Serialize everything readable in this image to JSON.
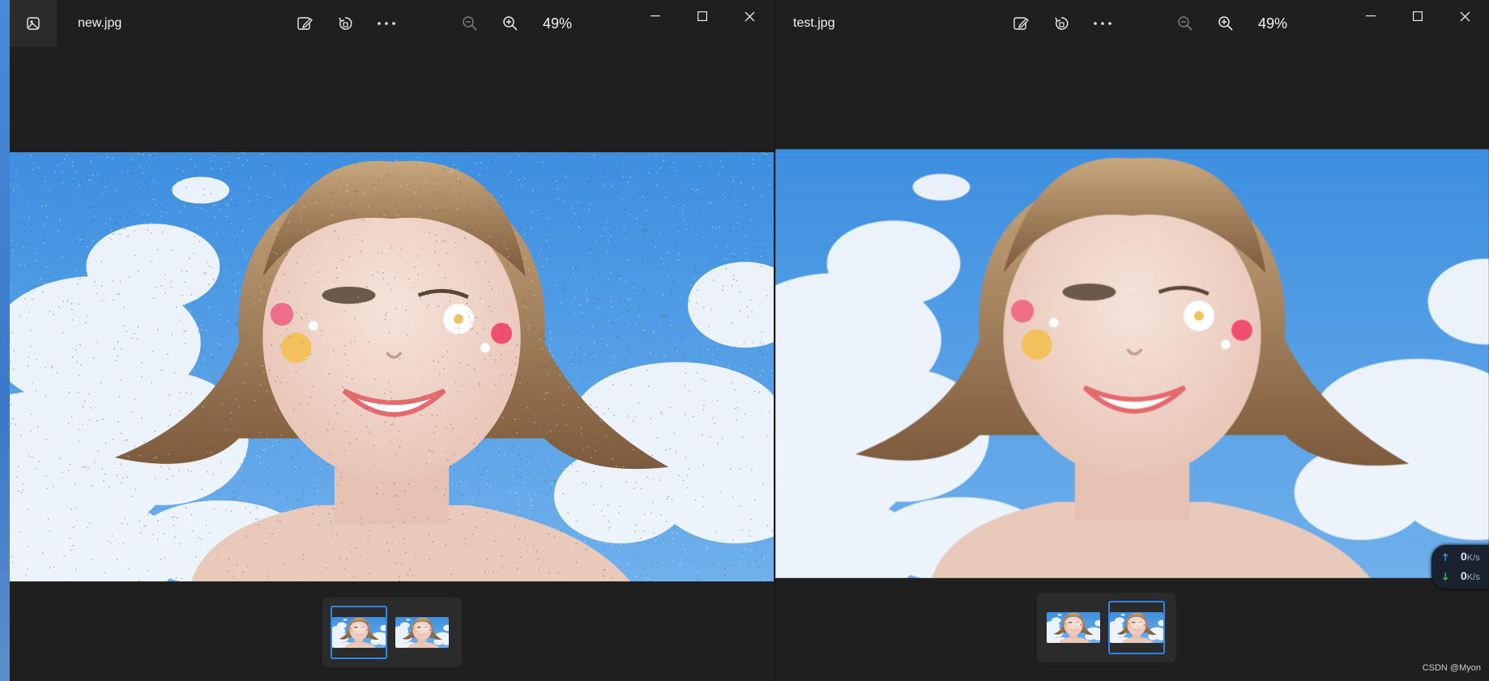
{
  "windows": [
    {
      "filename": "new.jpg",
      "zoom": "49%",
      "noisy": true,
      "selected_thumb": 0,
      "toolbar": [
        "edit-image-icon",
        "rotate-icon",
        "more-icon",
        "zoom-out-icon",
        "zoom-in-icon"
      ]
    },
    {
      "filename": "test.jpg",
      "zoom": "49%",
      "noisy": false,
      "selected_thumb": 1,
      "toolbar": [
        "edit-image-icon",
        "rotate-icon",
        "more-icon",
        "zoom-out-icon",
        "zoom-in-icon"
      ]
    }
  ],
  "caption_buttons": [
    "minimize-icon",
    "maximize-icon",
    "close-icon"
  ],
  "net_monitor": {
    "upload_value": "0",
    "upload_unit": "K/s",
    "download_value": "0",
    "download_unit": "K/s"
  },
  "watermark": "CSDN @Myon⁠",
  "colors": {
    "window_bg": "#1f1f1f",
    "accent": "#2f86e8",
    "sky": "#4a9ae6"
  }
}
